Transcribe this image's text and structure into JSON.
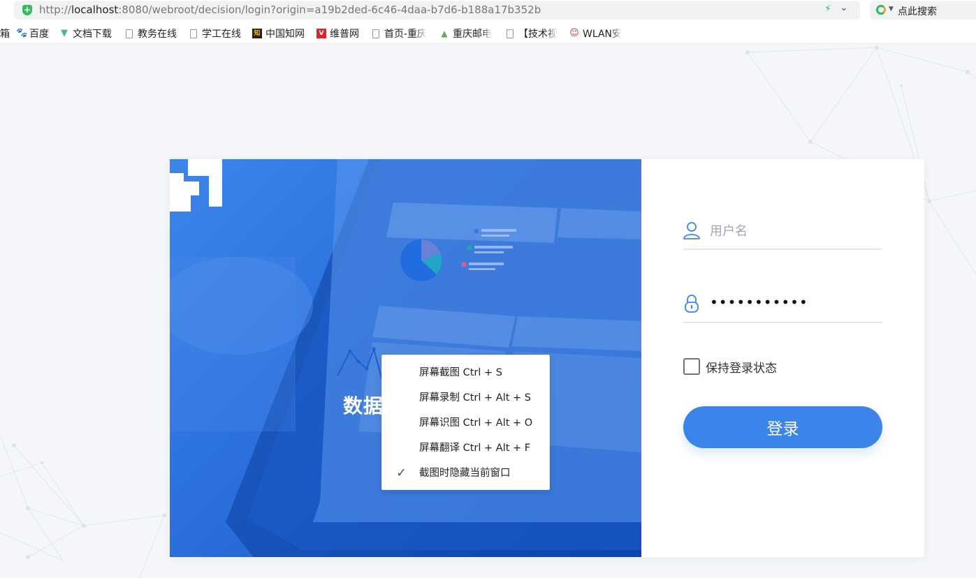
{
  "browser": {
    "url_host": "localhost",
    "url_prefix": "http://",
    "url_rest": ":8080/webroot/decision/login?origin=a19b2ded-6c46-4daa-b7d6-b188a17b352b",
    "search_placeholder": "点此搜索"
  },
  "bookmarks": [
    {
      "label": "箱",
      "icon": "none"
    },
    {
      "label": "百度",
      "icon": "paw-icon"
    },
    {
      "label": "文档下载",
      "icon": "vue-icon"
    },
    {
      "label": "教务在线",
      "icon": "document-icon"
    },
    {
      "label": "学工在线",
      "icon": "document-icon"
    },
    {
      "label": "中国知网",
      "icon": "cnki-icon"
    },
    {
      "label": "维普网",
      "icon": "vip-icon"
    },
    {
      "label": "首页-重庆",
      "icon": "document-icon"
    },
    {
      "label": "重庆邮电",
      "icon": "triangle-icon"
    },
    {
      "label": "【技术视",
      "icon": "document-icon"
    },
    {
      "label": "WLAN安",
      "icon": "person-icon"
    }
  ],
  "hero": {
    "brand_title": "数据决策系统"
  },
  "login": {
    "username_placeholder": "用户名",
    "password_value": "•••••••••••",
    "keep_label": "保持登录状态",
    "submit_label": "登录"
  },
  "context_menu": {
    "items": [
      {
        "label": "屏幕截图 Ctrl + S",
        "checked": false
      },
      {
        "label": "屏幕录制 Ctrl + Alt + S",
        "checked": false
      },
      {
        "label": "屏幕识图 Ctrl + Alt + O",
        "checked": false
      },
      {
        "label": "屏幕翻译 Ctrl + Alt + F",
        "checked": false
      },
      {
        "label": "截图时隐藏当前窗口",
        "checked": true
      }
    ]
  },
  "colors": {
    "accent": "#3b85ea",
    "hero_dark": "#0d4cbb",
    "secure": "#2fc05b"
  }
}
